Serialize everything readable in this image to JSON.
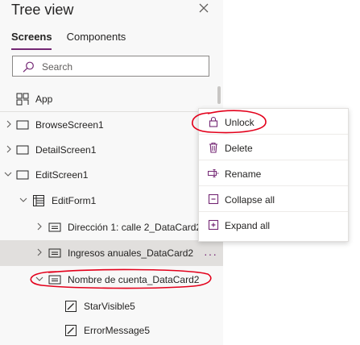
{
  "panel": {
    "title": "Tree view",
    "tabs": [
      {
        "label": "Screens",
        "active": true
      },
      {
        "label": "Components",
        "active": false
      }
    ],
    "search_placeholder": "Search"
  },
  "tree": {
    "app_label": "App",
    "items": [
      {
        "label": "BrowseScreen1"
      },
      {
        "label": "DetailScreen1"
      },
      {
        "label": "EditScreen1"
      },
      {
        "label": "EditForm1"
      },
      {
        "label": "Dirección 1: calle 2_DataCard2"
      },
      {
        "label": "Ingresos anuales_DataCard2"
      },
      {
        "label": "Nombre de cuenta_DataCard2"
      },
      {
        "label": "StarVisible5"
      },
      {
        "label": "ErrorMessage5"
      }
    ],
    "more_label": "···"
  },
  "context_menu": {
    "items": [
      {
        "label": "Unlock",
        "icon": "lock-icon"
      },
      {
        "label": "Delete",
        "icon": "trash-icon"
      },
      {
        "label": "Rename",
        "icon": "rename-icon"
      },
      {
        "label": "Collapse all",
        "icon": "collapse-icon"
      },
      {
        "label": "Expand all",
        "icon": "expand-icon"
      }
    ]
  },
  "colors": {
    "accent": "#742774",
    "annotation": "#e3001b",
    "selected_row": "#e1dfdd"
  }
}
